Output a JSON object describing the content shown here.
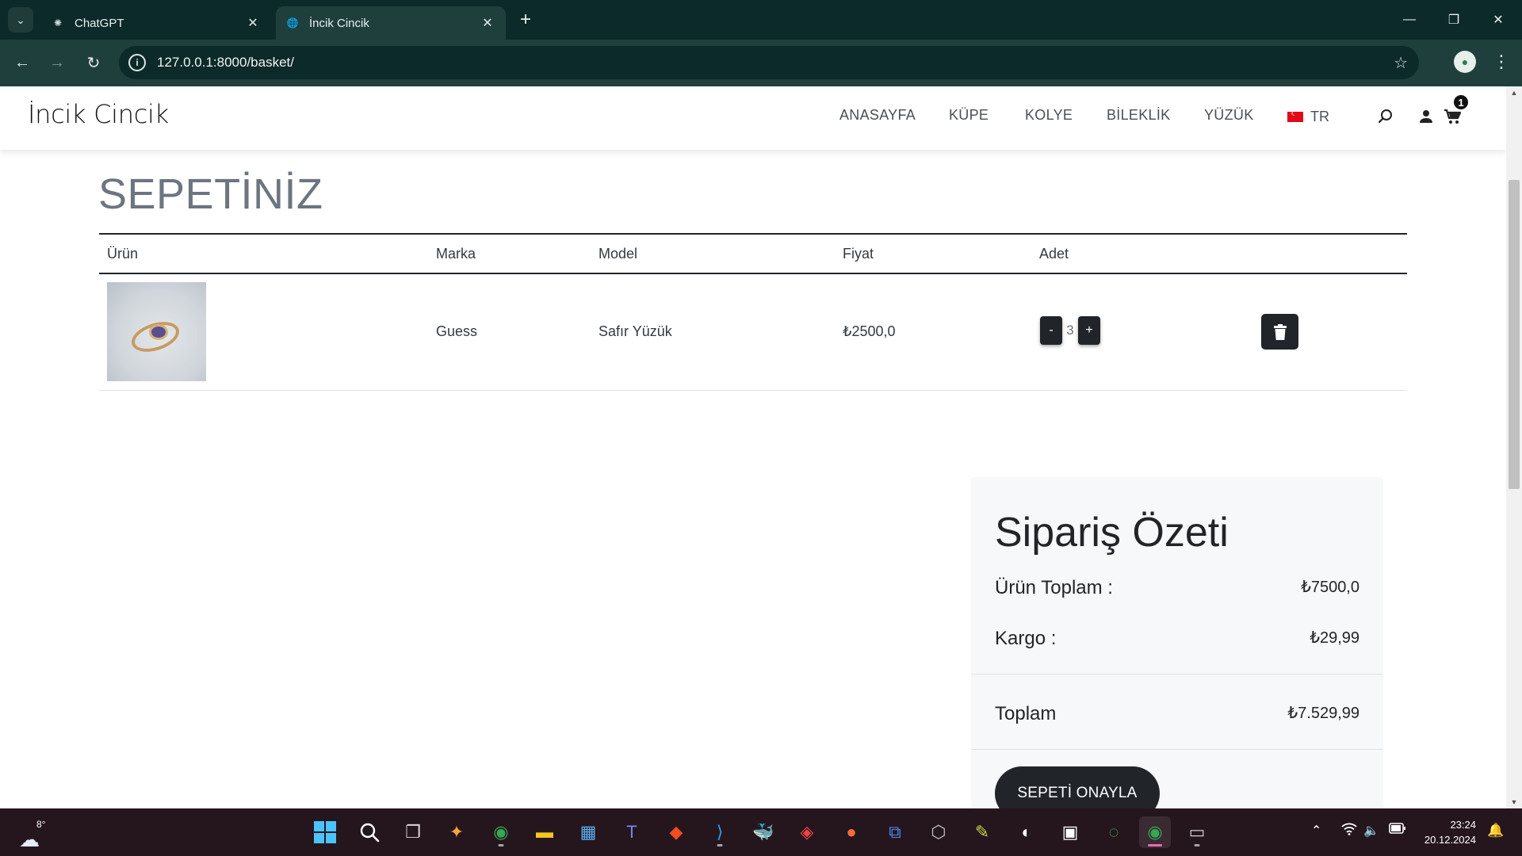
{
  "browser": {
    "tabs": [
      {
        "title": "ChatGPT",
        "icon": "chatgpt-icon"
      },
      {
        "title": "İncik Cincik",
        "icon": "globe-icon"
      }
    ],
    "url": "127.0.0.1:8000/basket/"
  },
  "site": {
    "logo": "İncik Cincik",
    "nav": [
      "ANASAYFA",
      "KÜPE",
      "KOLYE",
      "BİLEKLİK",
      "YÜZÜK"
    ],
    "lang": "TR",
    "cart_count": "1"
  },
  "basket": {
    "title": "SEPETİNİZ",
    "headers": {
      "product": "Ürün",
      "brand": "Marka",
      "model": "Model",
      "price": "Fiyat",
      "qty": "Adet"
    },
    "rows": [
      {
        "brand": "Guess",
        "model": "Safır Yüzük",
        "price": "₺2500,0",
        "qty": "3",
        "minus": "-",
        "plus": "+"
      }
    ]
  },
  "summary": {
    "title": "Sipariş Özeti",
    "subtotal_label": "Ürün Toplam :",
    "subtotal_value": "₺7500,0",
    "shipping_label": "Kargo :",
    "shipping_value": "₺29,99",
    "total_label": "Toplam",
    "total_value": "₺7.529,99",
    "confirm_label": "SEPETİ ONAYLA"
  },
  "taskbar": {
    "temperature": "8°",
    "time": "23:24",
    "date": "20.12.2024"
  },
  "colors": {
    "browser_frame": "#0c2a29",
    "toolbar": "#1f3f3d",
    "dark_button": "#212529",
    "summary_bg": "#f7f8f9",
    "taskbar": "#25161e"
  }
}
